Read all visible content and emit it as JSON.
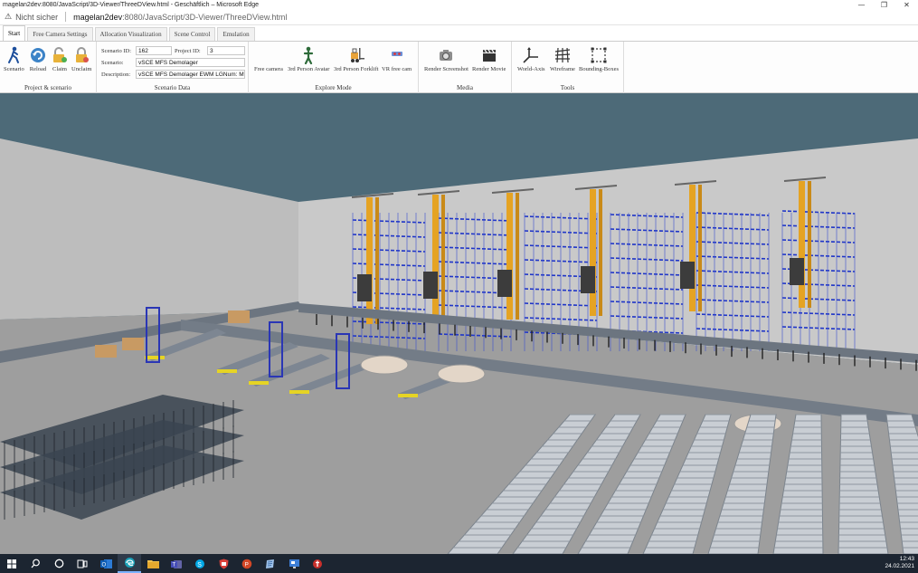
{
  "window": {
    "title": "magelan2dev:8080/JavaScript/3D-Viewer/ThreeDView.html - Geschäftlich – Microsoft Edge",
    "minimize": "—",
    "maximize": "❐",
    "close": "✕"
  },
  "addressbar": {
    "warning_icon": "⚠",
    "security_text": "Nicht sicher",
    "url_host": "magelan2dev",
    "url_rest": ":8080/JavaScript/3D-Viewer/ThreeDView.html"
  },
  "tabs": [
    {
      "label": "Start",
      "active": true
    },
    {
      "label": "Free Camera Settings",
      "active": false
    },
    {
      "label": "Allocation Visualization",
      "active": false
    },
    {
      "label": "Scene Control",
      "active": false
    },
    {
      "label": "Emulation",
      "active": false
    }
  ],
  "ribbon": {
    "project": {
      "label": "Project & scenario",
      "buttons": [
        {
          "label": "Scenario",
          "icon": "walking-person-icon"
        },
        {
          "label": "Reload",
          "icon": "reload-icon"
        },
        {
          "label": "Claim",
          "icon": "lock-open-icon"
        },
        {
          "label": "Unclaim",
          "icon": "lock-icon"
        }
      ]
    },
    "scenario_data": {
      "label": "Scenario Data",
      "scenario_id_label": "Scenario ID:",
      "scenario_id": "162",
      "project_id_label": "Project ID:",
      "project_id": "3",
      "scenario_label": "Scenario:",
      "scenario": "vSCE MFS Demolager",
      "description_label": "Description:",
      "description": "vSCE MFS Demolager EWM LGNum: MC"
    },
    "explore": {
      "label": "Explore Mode",
      "buttons": [
        {
          "label": "Free camera",
          "icon": "camera-icon"
        },
        {
          "label": "3rd Person Avatar",
          "icon": "avatar-icon"
        },
        {
          "label": "3rd Person Forklift",
          "icon": "forklift-icon"
        },
        {
          "label": "VR free cam",
          "icon": "vr-headset-icon"
        }
      ]
    },
    "media": {
      "label": "Media",
      "buttons": [
        {
          "label": "Render Screenshot",
          "icon": "photo-camera-icon"
        },
        {
          "label": "Render Movie",
          "icon": "clapperboard-icon"
        }
      ]
    },
    "tools": {
      "label": "Tools",
      "buttons": [
        {
          "label": "World-Axis",
          "icon": "axis-icon"
        },
        {
          "label": "Wireframe",
          "icon": "wireframe-icon"
        },
        {
          "label": "Bounding-Boxes",
          "icon": "bounding-box-icon"
        }
      ]
    }
  },
  "taskbar": {
    "time": "12:43",
    "date": "24.02.2021"
  },
  "colors": {
    "sky": "#4d6a78",
    "floor": "#9e9e9e",
    "wall": "#c9c9c9",
    "rack_blue": "#1f35c8",
    "crane_yellow": "#e5a323",
    "taskbar": "#1c2531"
  }
}
